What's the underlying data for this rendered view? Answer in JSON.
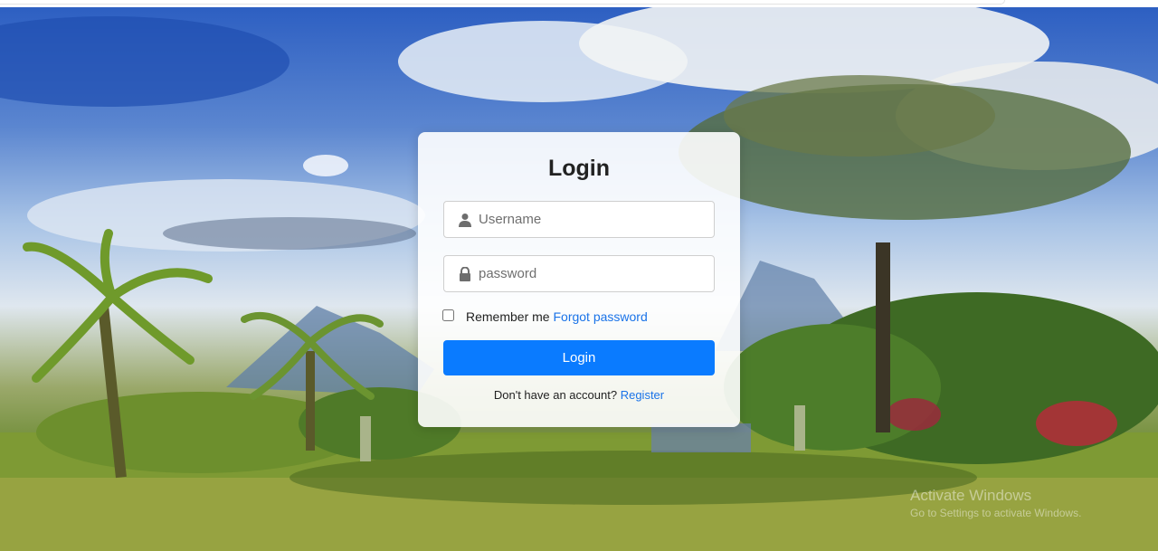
{
  "login": {
    "title": "Login",
    "username_placeholder": "Username",
    "password_placeholder": "password",
    "remember_label": "Remember me",
    "forgot_link": "Forgot password",
    "submit_label": "Login",
    "register_prompt": "Don't have an account?",
    "register_link": "Register"
  },
  "icons": {
    "username": "user-icon",
    "password": "lock-icon"
  },
  "watermark": {
    "title": "Activate Windows",
    "subtitle": "Go to Settings to activate Windows."
  },
  "colors": {
    "accent": "#0a7bff",
    "link": "#1a73e8"
  }
}
